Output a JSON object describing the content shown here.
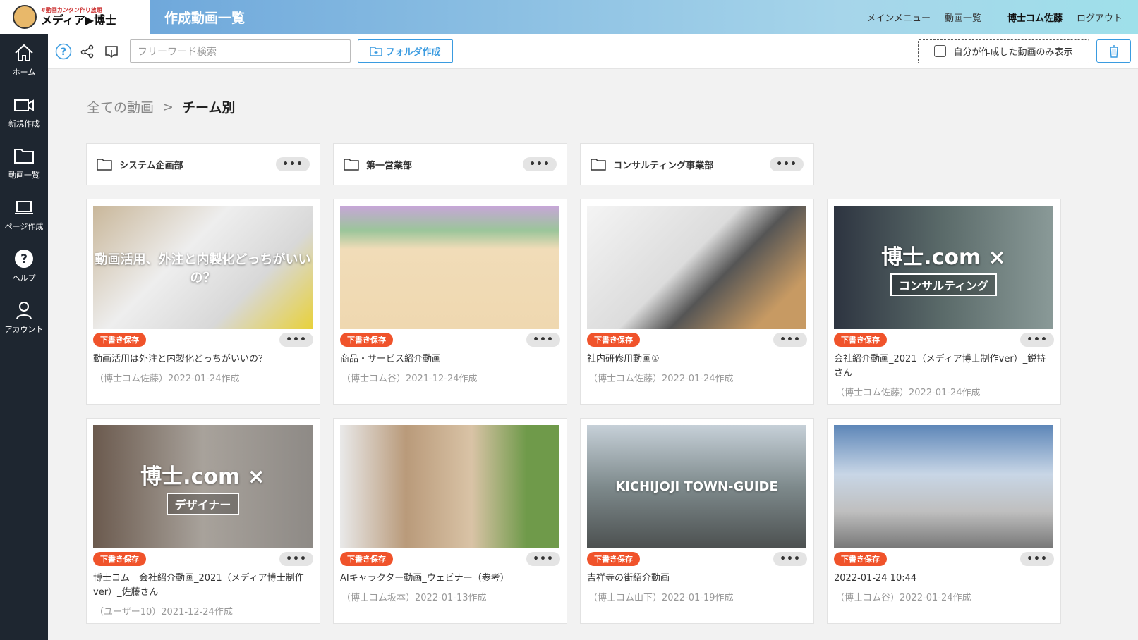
{
  "logo": {
    "tagline": "#動画カンタン作り放題",
    "name": "メディア▶博士"
  },
  "header": {
    "title": "作成動画一覧",
    "nav": [
      "メインメニュー",
      "動画一覧"
    ],
    "user": "博士コム佐藤",
    "logout": "ログアウト"
  },
  "sidebar": [
    {
      "label": "ホーム",
      "icon": "home-icon"
    },
    {
      "label": "新規作成",
      "icon": "video-camera-icon"
    },
    {
      "label": "動画一覧",
      "icon": "folder-icon"
    },
    {
      "label": "ページ作成",
      "icon": "laptop-icon"
    },
    {
      "label": "ヘルプ",
      "icon": "help-icon"
    },
    {
      "label": "アカウント",
      "icon": "user-icon"
    }
  ],
  "toolbar": {
    "search_placeholder": "フリーワード検索",
    "folder_button": "フォルダ作成",
    "only_mine": "自分が作成した動画のみ表示"
  },
  "breadcrumb": {
    "root": "全ての動画",
    "sep": ">",
    "current": "チーム別"
  },
  "folders": [
    {
      "name": "システム企画部"
    },
    {
      "name": "第一営業部"
    },
    {
      "name": "コンサルティング事業部"
    }
  ],
  "more": "•••",
  "videos": [
    {
      "badge": "下書き保存",
      "title": "動画活用は外注と内製化どっちがいいの？",
      "meta": "（博士コム佐藤）2022-01-24作成",
      "overlay": "動画活用、外注と内製化どっちがいいの？",
      "sub": "",
      "bg": "linear-gradient(135deg,#c9b79a,#eeeeee 40%,#d8d8d8 70%,#e8d13a)"
    },
    {
      "badge": "下書き保存",
      "title": "商品・サービス紹介動画",
      "meta": "（博士コム谷）2021-12-24作成",
      "overlay": "",
      "sub": "",
      "bg": "linear-gradient(180deg,#c7a6d8 0%,#9bc59a 20%,#f1dcb8 35%,#efd8b0 100%)"
    },
    {
      "badge": "下書き保存",
      "title": "社内研修用動画①",
      "meta": "（博士コム佐藤）2022-01-24作成",
      "overlay": "",
      "sub": "",
      "bg": "linear-gradient(135deg,#f4f4f4,#dcdcdc 45%,#555 60%,#c79a63 85%)"
    },
    {
      "badge": "下書き保存",
      "title": "会社紹介動画_2021（メディア博士制作ver）_鋭持さん",
      "meta": "（博士コム佐藤）2022-01-24作成",
      "overlay": "博士.com ×",
      "sub": "コンサルティング",
      "bg": "linear-gradient(90deg,#2d3440,#5b6b6a 50%,#8a9a98)"
    },
    {
      "badge": "下書き保存",
      "title": "博士コム　会社紹介動画_2021（メディア博士制作ver）_佐藤さん",
      "meta": "（ユーザー10）2021-12-24作成",
      "overlay": "博士.com ×",
      "sub": "デザイナー",
      "bg": "linear-gradient(90deg,#6b5a4e,#a8a29b 50%,#8e8a86)"
    },
    {
      "badge": "下書き保存",
      "title": "AIキャラクター動画_ウェビナー（参考）",
      "meta": "（博士コム坂本）2022-01-13作成",
      "overlay": "",
      "sub": "",
      "bg": "linear-gradient(90deg,#e9e9e9,#b99a7a 30%,#d9c3a6 60%,#6f9a4a 85%)"
    },
    {
      "badge": "下書き保存",
      "title": "吉祥寺の街紹介動画",
      "meta": "（博士コム山下）2022-01-19作成",
      "overlay": "KICHIJOJI TOWN-GUIDE",
      "sub": "",
      "bg": "linear-gradient(180deg,#c6d0d8,#7e8a8c 50%,#4c5050)"
    },
    {
      "badge": "下書き保存",
      "title": "2022-01-24 10:44",
      "meta": "（博士コム谷）2022-01-24作成",
      "overlay": "",
      "sub": "",
      "bg": "linear-gradient(180deg,#5d86b8,#c8d6e6 40%,#bfbfbf 70%,#777)"
    }
  ]
}
